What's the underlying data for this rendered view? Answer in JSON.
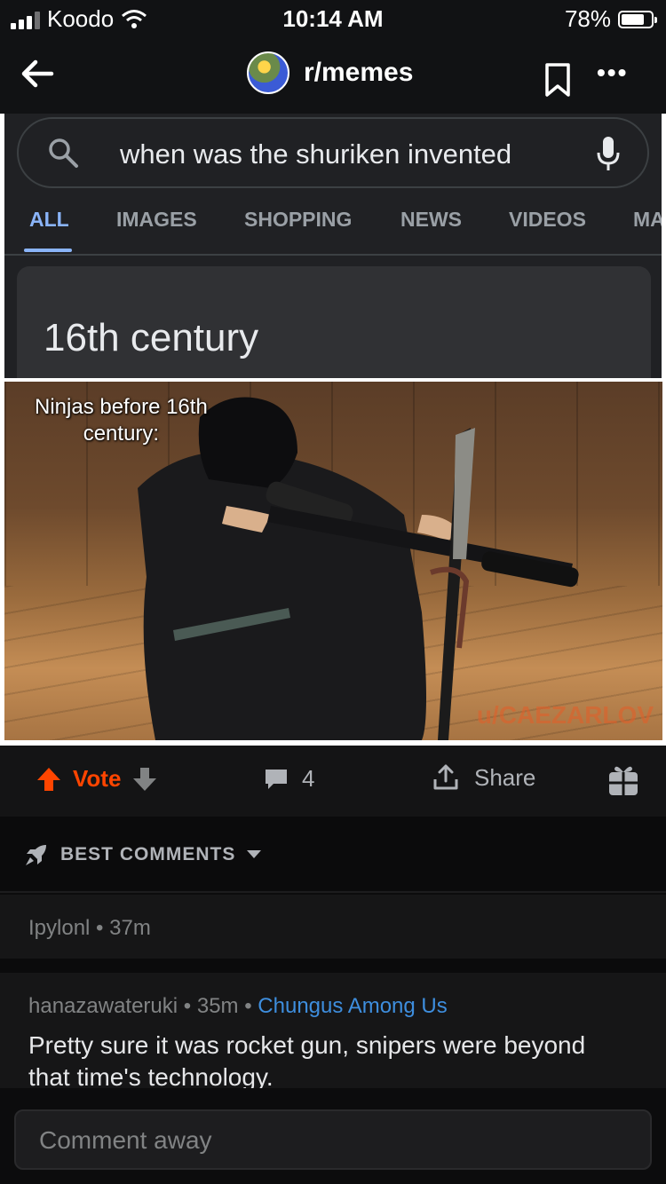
{
  "status_bar": {
    "carrier": "Koodo",
    "time": "10:14 AM",
    "battery": "78%",
    "battery_level": 0.78
  },
  "nav": {
    "subreddit": "r/memes"
  },
  "meme": {
    "search_query": "when was the shuriken invented",
    "tabs": [
      "ALL",
      "IMAGES",
      "SHOPPING",
      "NEWS",
      "VIDEOS",
      "MA"
    ],
    "answer": "16th century",
    "caption": "Ninjas before 16th\ncentury:",
    "watermark": "u/CAEZARLOV"
  },
  "actions": {
    "vote_label": "Vote",
    "comment_count": "4",
    "share_label": "Share"
  },
  "sort": {
    "label": "BEST COMMENTS"
  },
  "comments": [
    {
      "author": "Ipylonl",
      "age": "37m"
    },
    {
      "author": "hanazawateruki",
      "age": "35m",
      "flair": "Chungus Among Us",
      "body": "Pretty sure it was rocket gun, snipers were beyond that time's technology."
    }
  ],
  "composer": {
    "placeholder": "Comment away"
  },
  "colors": {
    "upvote": "#ff4500",
    "flair": "#3e8ede",
    "google_accent": "#8ab4f8"
  }
}
